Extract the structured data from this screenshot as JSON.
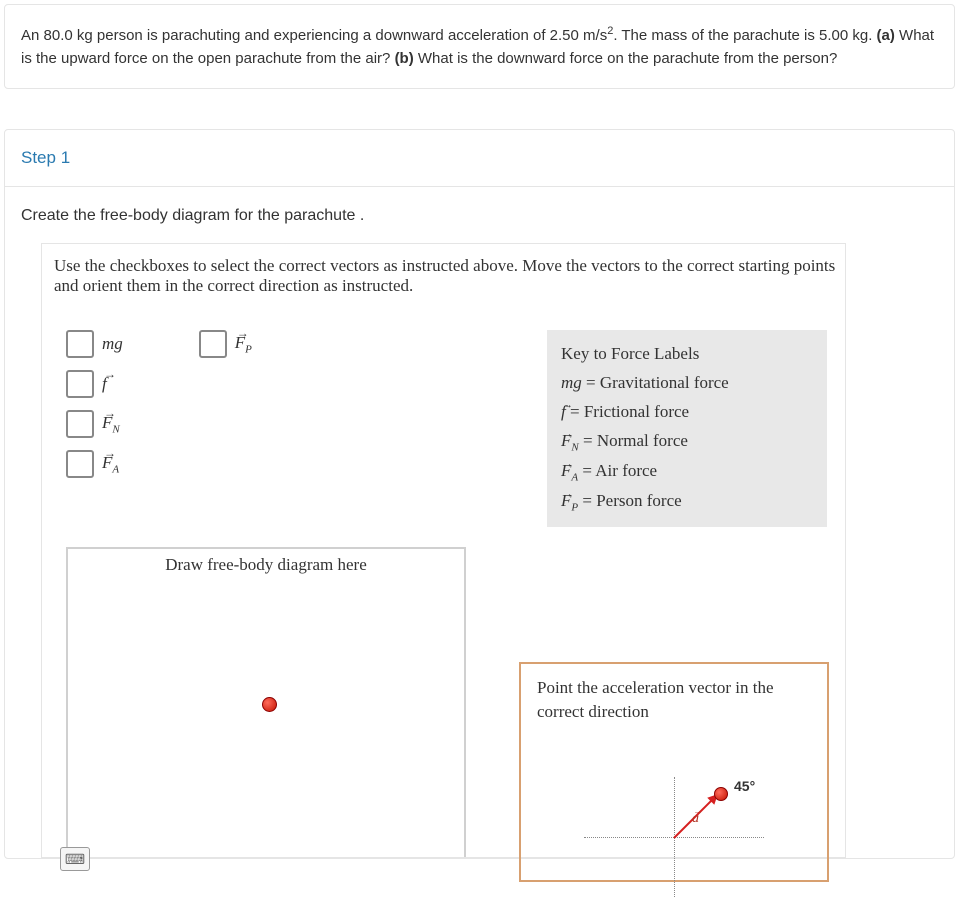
{
  "problem": {
    "text_before_sup": "An 80.0 kg person is parachuting and experiencing a downward acceleration of 2.50 m/s",
    "sup": "2",
    "text_after_sup": ". The mass of the parachute is 5.00 kg. ",
    "part_a_label": "(a)",
    "part_a_text": " What is the upward force on the open parachute from the air? ",
    "part_b_label": "(b)",
    "part_b_text": " What is the downward force on the parachute from the person?"
  },
  "step": {
    "label": "Step 1",
    "instruction": "Create the free-body diagram for the parachute .",
    "canvas_instruction": "Use the checkboxes to select the correct vectors as instructed above. Move the vectors to the correct starting points and orient them in the correct direction as instructed."
  },
  "checkboxes": {
    "mg": "mg",
    "f": "f",
    "fn_base": "F",
    "fn_sub": "N",
    "fa_base": "F",
    "fa_sub": "A",
    "fp_base": "F",
    "fp_sub": "P"
  },
  "key": {
    "title": "Key to Force Labels",
    "rows": [
      {
        "sym_html": "mg",
        "def": "Gravitational force"
      },
      {
        "sym_html": "f⃗",
        "def": "Frictional force"
      },
      {
        "sym_html": "F⃗_N",
        "def": "Normal force"
      },
      {
        "sym_html": "F⃗_A",
        "def": "Air force"
      },
      {
        "sym_html": "F⃗_P",
        "def": "Person force"
      }
    ],
    "mg": "mg",
    "mg_def": "Gravitational force",
    "f": "f",
    "f_def": "Frictional force",
    "fn": "F",
    "fn_sub": "N",
    "fn_def": "Normal force",
    "fa": "F",
    "fa_sub": "A",
    "fa_def": "Air force",
    "fp": "F",
    "fp_sub": "P",
    "fp_def": "Person force",
    "eq": " = "
  },
  "fbd": {
    "title": "Draw free-body diagram here"
  },
  "accel": {
    "text": "Point the acceleration vector in the correct direction",
    "angle": "45°",
    "vec_label": "a"
  }
}
